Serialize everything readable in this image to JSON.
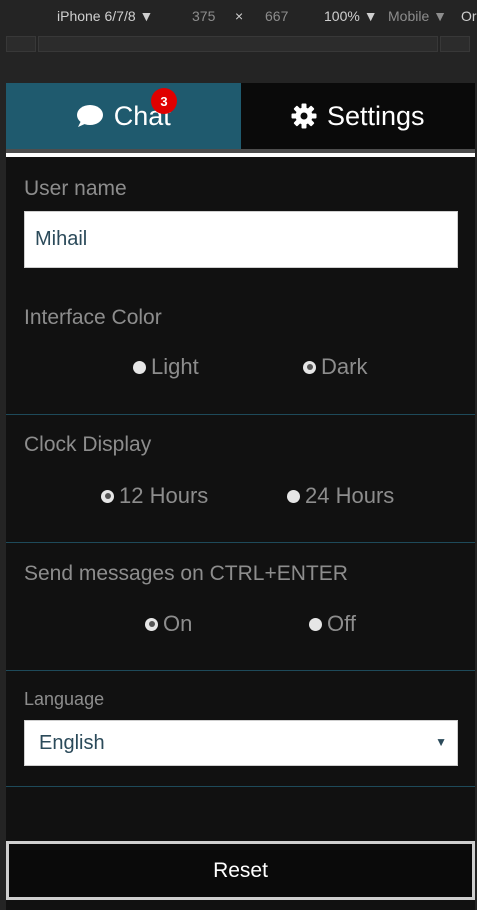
{
  "devtools": {
    "device": "iPhone 6/7/8",
    "width": "375",
    "times": "×",
    "height": "667",
    "zoom": "100%",
    "mode": "Mobile",
    "extra": "Or"
  },
  "tabs": {
    "chat_label": "Chat",
    "chat_badge": "3",
    "settings_label": "Settings"
  },
  "settings": {
    "username_label": "User name",
    "username_value": "Mihail",
    "color_label": "Interface Color",
    "color_options": [
      "Light",
      "Dark"
    ],
    "color_selected": "Dark",
    "clock_label": "Clock Display",
    "clock_options": [
      "12 Hours",
      "24 Hours"
    ],
    "clock_selected": "12 Hours",
    "send_label": "Send messages on CTRL+ENTER",
    "send_options": [
      "On",
      "Off"
    ],
    "send_selected": "On",
    "language_label": "Language",
    "language_value": "English"
  },
  "reset_label": "Reset",
  "colors": {
    "active_tab": "#1f5a6e",
    "badge": "#e00000",
    "background": "#111111"
  }
}
